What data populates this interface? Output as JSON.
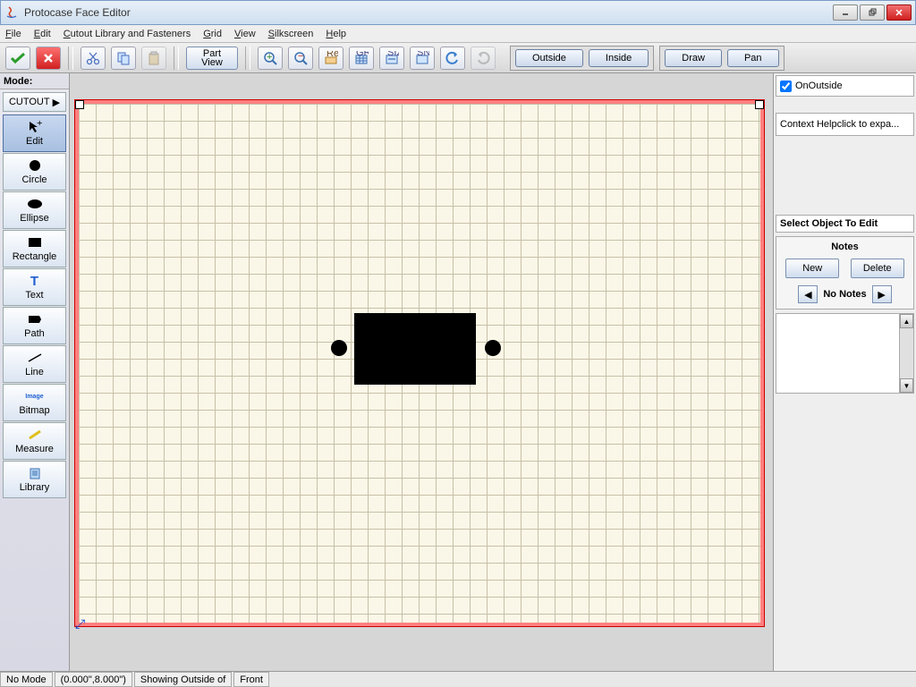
{
  "window": {
    "title": "Protocase Face Editor"
  },
  "menu": {
    "file": "File",
    "edit": "Edit",
    "cutout": "Cutout Library and Fasteners",
    "grid": "Grid",
    "view": "View",
    "silkscreen": "Silkscreen",
    "help": "Help"
  },
  "toolbar": {
    "partview1": "Part",
    "partview2": "View",
    "outside": "Outside",
    "inside": "Inside",
    "draw": "Draw",
    "pan": "Pan"
  },
  "left": {
    "mode": "Mode:",
    "cutout": "CUTOUT",
    "tools": [
      "Edit",
      "Circle",
      "Ellipse",
      "Rectangle",
      "Text",
      "Path",
      "Line",
      "Bitmap",
      "Measure",
      "Library"
    ]
  },
  "right": {
    "onoutside": "OnOutside",
    "ctxhelp": "Context Helpclick to expa...",
    "selobj": "Select Object To Edit",
    "notes": "Notes",
    "new": "New",
    "delete": "Delete",
    "nonotes": "No Notes"
  },
  "status": {
    "mode": "No Mode",
    "coords": "(0.000\",8.000\")",
    "showing": "Showing Outside of",
    "face": "Front"
  }
}
